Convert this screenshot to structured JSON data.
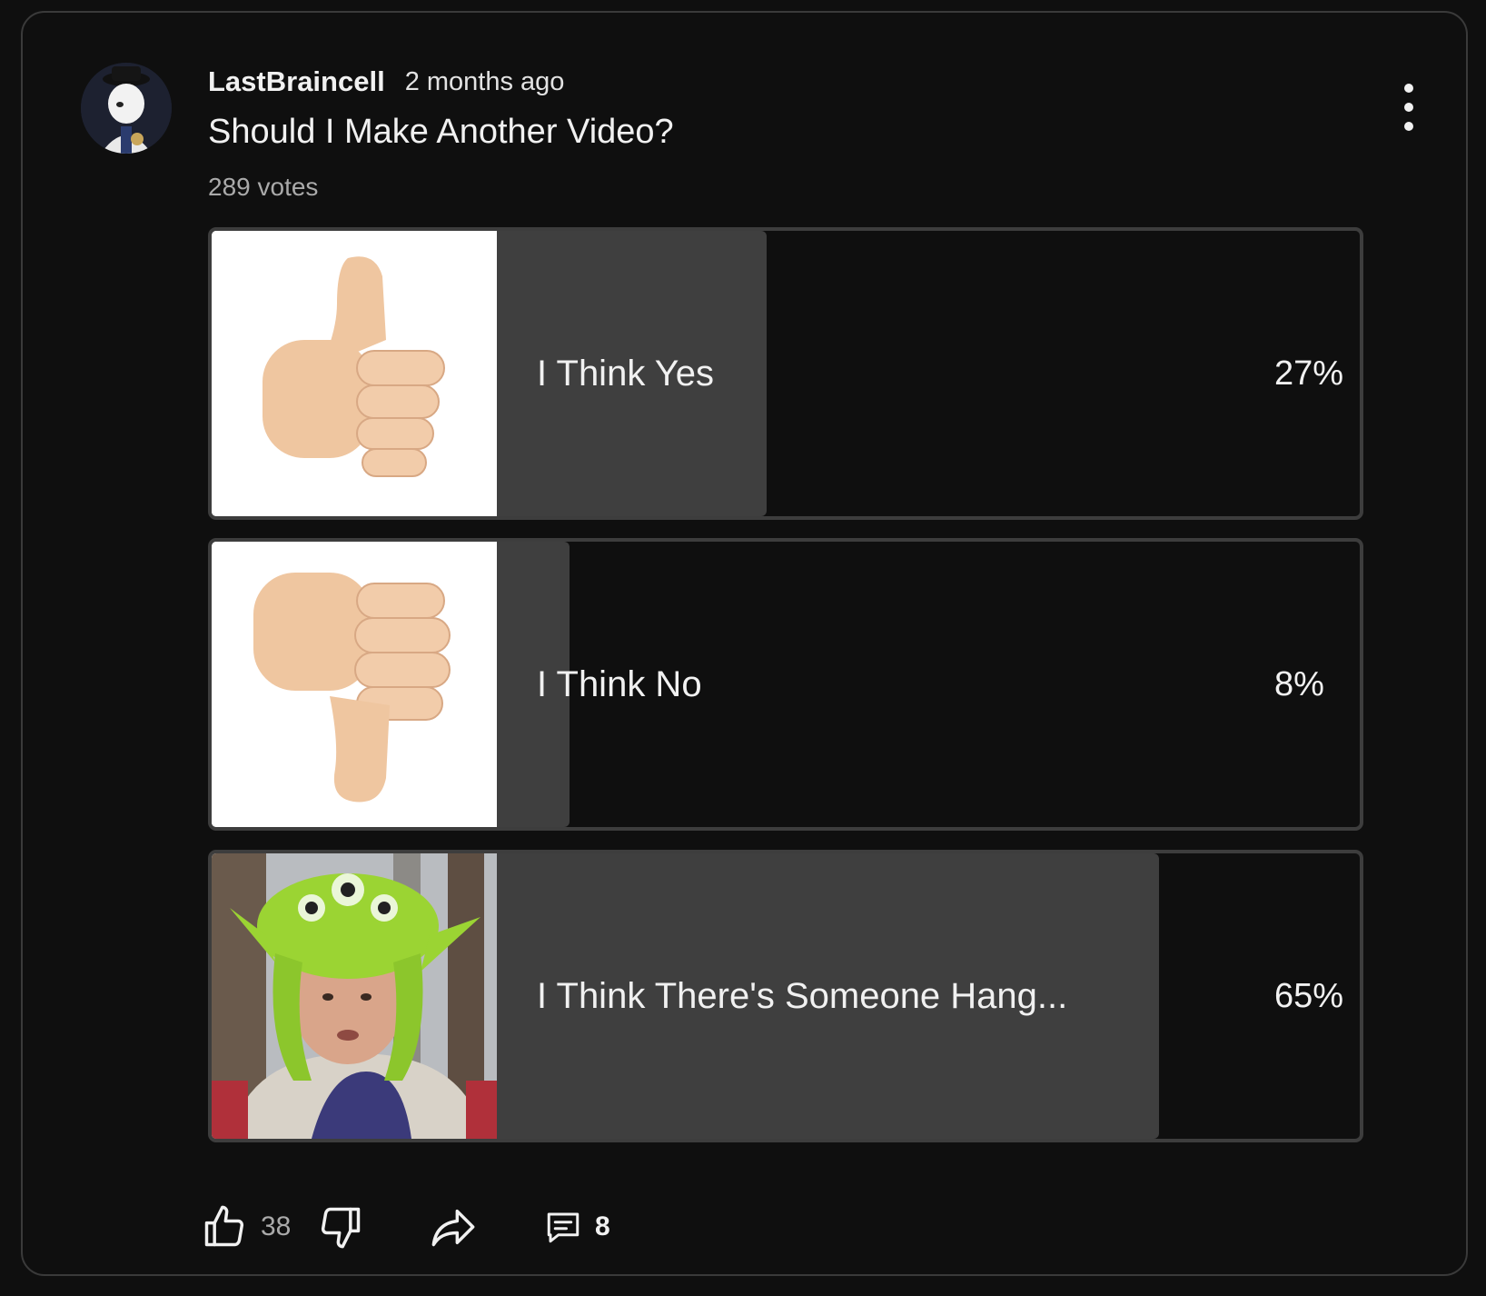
{
  "post": {
    "author": "LastBraincell",
    "time": "2 months ago",
    "title": "Should I Make Another Video?",
    "votes": "289 votes"
  },
  "poll": {
    "options": [
      {
        "label": "I Think Yes",
        "percent": "27%",
        "fill_fraction": 0.27,
        "thumb_icon": "thumbs-up-emoji"
      },
      {
        "label": "I Think No",
        "percent": "8%",
        "fill_fraction": 0.08,
        "thumb_icon": "thumbs-down-emoji"
      },
      {
        "label": "I Think There's Someone Hang...",
        "percent": "65%",
        "fill_fraction": 0.65,
        "thumb_icon": "person-alien-hat-photo"
      }
    ]
  },
  "actions": {
    "like_count": "38",
    "comment_count": "8"
  },
  "colors": {
    "background": "#0f0f0f",
    "fill": "#3f3f3f",
    "border": "#3d3d3d",
    "text": "#f1f1f1",
    "muted": "#aaaaaa"
  }
}
